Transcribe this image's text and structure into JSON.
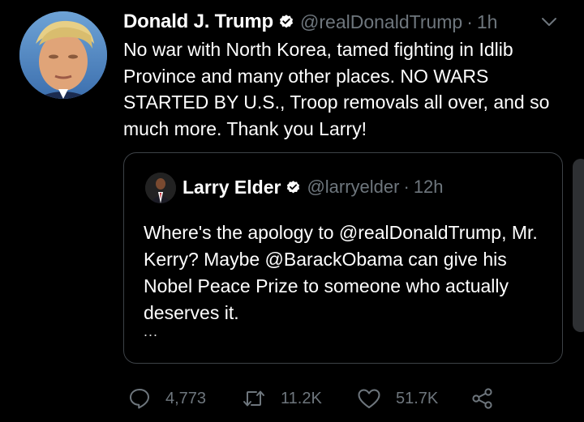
{
  "tweet": {
    "display_name": "Donald J. Trump",
    "handle": "@realDonaldTrump",
    "separator": "·",
    "time": "1h",
    "text": "No war with North Korea, tamed fighting in Idlib Province and many other places. NO WARS STARTED BY U.S., Troop removals all over, and so much more. Thank you Larry!",
    "verified_icon": "verified-badge-icon",
    "menu_icon": "chevron-down-icon"
  },
  "quoted": {
    "display_name": "Larry Elder",
    "handle": "@larryelder",
    "separator": "·",
    "time": "12h",
    "text": "Where's the apology to @realDonaldTrump, Mr. Kerry? Maybe @BarackObama can give his Nobel Peace Prize to someone who actually deserves it.",
    "ellipsis": "..."
  },
  "actions": {
    "replies": "4,773",
    "retweets": "11.2K",
    "likes": "51.7K",
    "reply_icon": "reply-icon",
    "retweet_icon": "retweet-icon",
    "like_icon": "heart-icon",
    "share_icon": "share-icon"
  },
  "colors": {
    "background": "#000000",
    "primary_text": "#ffffff",
    "secondary_text": "#6e767d",
    "border": "#3d4247"
  }
}
